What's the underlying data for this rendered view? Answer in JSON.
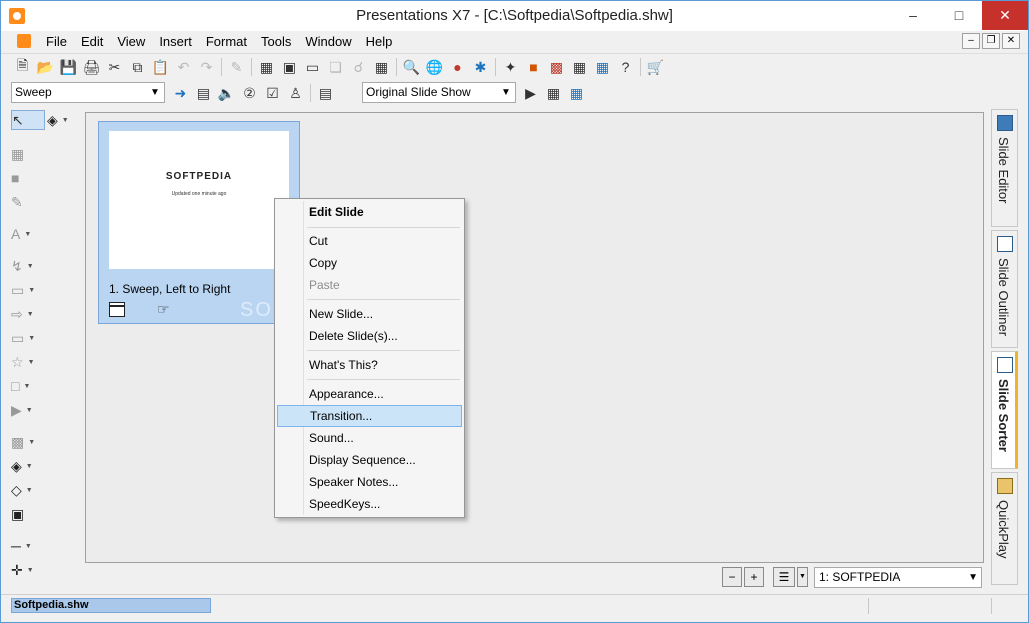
{
  "window": {
    "title": "Presentations X7 - [C:\\Softpedia\\Softpedia.shw]",
    "min": "–",
    "max": "□",
    "close": "✕"
  },
  "menu": {
    "items": [
      "File",
      "Edit",
      "View",
      "Insert",
      "Format",
      "Tools",
      "Window",
      "Help"
    ],
    "mdi_min": "–",
    "mdi_restore": "❐",
    "mdi_close": "✕"
  },
  "toolbar2": {
    "transition_value": "Sweep",
    "show_value": "Original Slide Show"
  },
  "slide": {
    "heading": "SOFTPEDIA",
    "subheading": "Updated one minute ago",
    "caption": "1. Sweep, Left to Right"
  },
  "watermark": "SOFTPEDIA",
  "context_menu": {
    "items": [
      {
        "label": "Edit Slide"
      },
      {
        "label": "Cut"
      },
      {
        "label": "Copy"
      },
      {
        "label": "Paste"
      },
      {
        "label": "New Slide..."
      },
      {
        "label": "Delete Slide(s)..."
      },
      {
        "label": "What's This?"
      },
      {
        "label": "Appearance..."
      },
      {
        "label": "Transition..."
      },
      {
        "label": "Sound..."
      },
      {
        "label": "Display Sequence..."
      },
      {
        "label": "Speaker Notes..."
      },
      {
        "label": "SpeedKeys..."
      }
    ]
  },
  "right_tabs": {
    "tabs": [
      "Slide Editor",
      "Slide Outliner",
      "Slide Sorter",
      "QuickPlay"
    ],
    "active": "Slide Sorter"
  },
  "bottom": {
    "slide_select_value": "1: SOFTPEDIA"
  },
  "status": {
    "file": "Softpedia.shw"
  },
  "colors": {
    "accent_blue": "#3d7cb8",
    "selection": "#b9d5f2",
    "close_red": "#c7312b",
    "active_tab_marker": "#f0b429"
  }
}
